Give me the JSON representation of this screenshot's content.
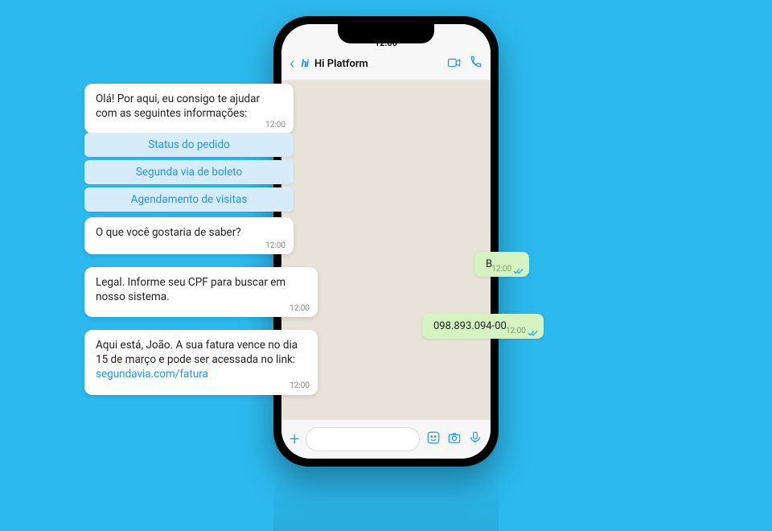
{
  "status_time": "12:00",
  "header": {
    "brand": "hi",
    "title": "Hi Platform"
  },
  "bot": {
    "intro": "Olá! Por aqui, eu consigo te ajudar com as seguintes informações:",
    "intro_ts": "12:00",
    "options": [
      "Status do pedido",
      "Segunda via de boleto",
      "Agendamento de visitas"
    ],
    "prompt": "O que você gostaria de saber?",
    "prompt_ts": "12:00",
    "followup": "Legal. Informe seu CPF para buscar em nosso sistema.",
    "followup_ts": "12:00",
    "answer_pre": "Aqui está, João. A sua fatura vence no dia 15 de março e pode ser acessada no link: ",
    "answer_link": "segundavia.com/fatura",
    "answer_ts": "12:00"
  },
  "user": {
    "reply1": "B",
    "reply1_ts": "12:00",
    "reply2": "098.893.094-00",
    "reply2_ts": "12:00"
  }
}
